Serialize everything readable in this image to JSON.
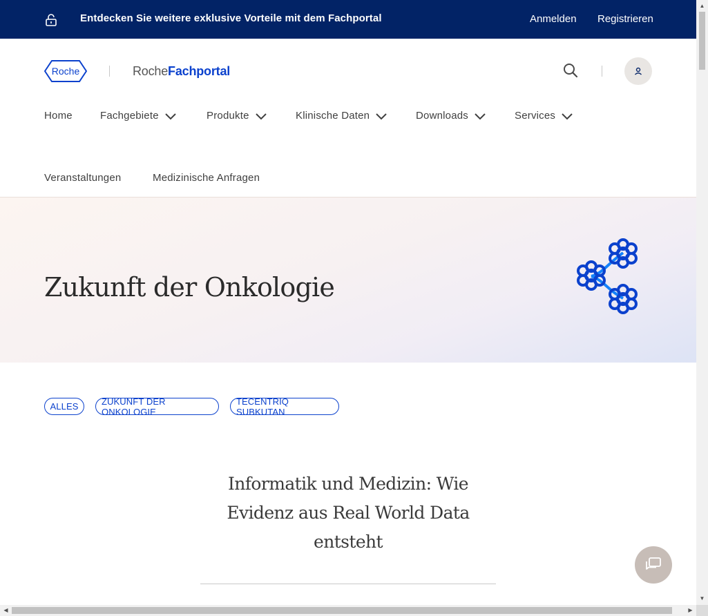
{
  "topbar": {
    "promo_text": "Entdecken Sie weitere exklusive Vorteile mit dem Fachportal",
    "login_label": "Anmelden",
    "register_label": "Registrieren",
    "background": "#022366"
  },
  "header": {
    "logo_text": "Roche",
    "brand_prefix": "Roche",
    "brand_suffix": "Fachportal",
    "accent_color": "#0b41cd"
  },
  "nav": {
    "items": [
      {
        "label": "Home",
        "dropdown": false
      },
      {
        "label": "Fachgebiete",
        "dropdown": true
      },
      {
        "label": "Produkte",
        "dropdown": true
      },
      {
        "label": "Klinische Daten",
        "dropdown": true
      },
      {
        "label": "Downloads",
        "dropdown": true
      },
      {
        "label": "Services",
        "dropdown": true
      },
      {
        "label": "Veranstaltungen",
        "dropdown": false
      },
      {
        "label": "Medizinische Anfragen",
        "dropdown": false
      }
    ]
  },
  "hero": {
    "title": "Zukunft der Onkologie",
    "illustration_icon": "molecule-network-icon"
  },
  "filters": {
    "chips": [
      "ALLES",
      "ZUKUNFT DER ONKOLOGIE",
      "TECENTRIQ SUBKUTAN"
    ]
  },
  "article": {
    "title": "Informatik und Medizin: Wie Evidenz aus Real World Data entsteht"
  },
  "icons": {
    "lock": "lock-open-icon",
    "search": "search-icon",
    "user": "user-icon",
    "chat": "chat-icon"
  }
}
